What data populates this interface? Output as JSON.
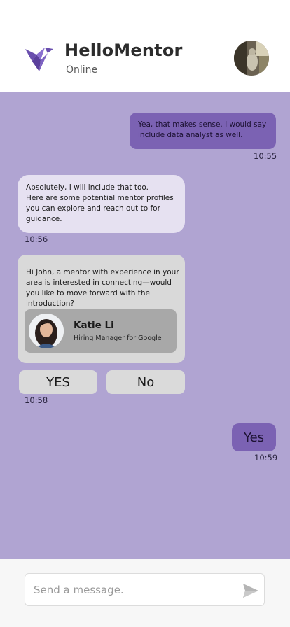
{
  "header": {
    "app_name": "HelloMentor",
    "status": "Online",
    "logo_icon": "origami-bird-icon",
    "brand_color": "#6a4fae"
  },
  "messages": [
    {
      "from": "user",
      "text": "Yea, that makes sense. I would say include data analyst as well.",
      "time": "10:55"
    },
    {
      "from": "bot",
      "text": "Absolutely, I will include that too.\nHere are some potential mentor profiles you can explore and reach out to for guidance.",
      "time": "10:56"
    },
    {
      "from": "bot",
      "text": "Hi John, a mentor with experience in your area is interested in connecting—would you like to move forward with the introduction?"
    },
    {
      "from": "user",
      "text": "Yes",
      "time": "10:59"
    }
  ],
  "mentor_card": {
    "name": "Katie Li",
    "role": "Hiring Manager for Google"
  },
  "choices": {
    "yes_label": "YES",
    "no_label": "No",
    "time": "10:58"
  },
  "composer": {
    "placeholder": "Send a message.",
    "value": "",
    "send_icon": "send-icon"
  },
  "colors": {
    "chat_background": "#b0a4d2",
    "outgoing_bubble": "#7b62b3",
    "incoming_bubble": "#e6e1f1",
    "card_background": "#d9d9d9"
  }
}
